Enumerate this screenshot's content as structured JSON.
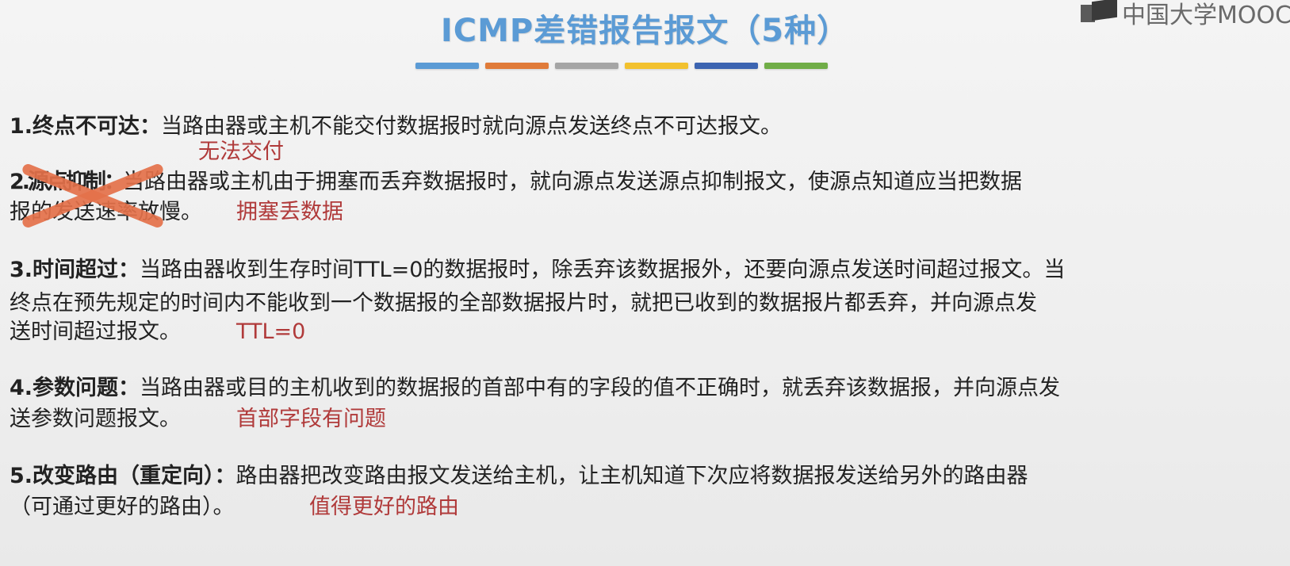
{
  "title": "ICMP差错报告报文（5种）",
  "stripe_colors": [
    "#5b9bd5",
    "#e07b39",
    "#a5a5a5",
    "#f2c12e",
    "#3c64b1",
    "#70ad47"
  ],
  "logo": {
    "icon": "mooc-book-icon",
    "text": "中国大学MOOC"
  },
  "items": [
    {
      "label": "1.终点不可达：",
      "lines": [
        "当路由器或主机不能交付数据报时就向源点发送终点不可达报文。"
      ],
      "note": "无法交付"
    },
    {
      "label": "2.源点抑制：",
      "lines": [
        "当路由器或主机由于拥塞而丢弃数据报时，就向源点发送源点抑制报文，使源点知道应当把数据",
        "报的发送速率放慢。"
      ],
      "note": "拥塞丢数据",
      "struck": true
    },
    {
      "label": "3.时间超过：",
      "lines": [
        "当路由器收到生存时间TTL=0的数据报时，除丢弃该数据报外，还要向源点发送时间超过报文。当",
        "终点在预先规定的时间内不能收到一个数据报的全部数据报片时，就把已收到的数据报片都丢弃，并向源点发",
        "送时间超过报文。"
      ],
      "note": "TTL=0"
    },
    {
      "label": "4.参数问题：",
      "lines": [
        "当路由器或目的主机收到的数据报的首部中有的字段的值不正确时，就丢弃该数据报，并向源点发",
        "送参数问题报文。"
      ],
      "note": "首部字段有问题"
    },
    {
      "label": "5.改变路由（重定向）：",
      "lines": [
        "路由器把改变路由报文发送给主机，让主机知道下次应将数据报发送给另外的路由器",
        "（可通过更好的路由）。"
      ],
      "note": "值得更好的路由"
    }
  ]
}
